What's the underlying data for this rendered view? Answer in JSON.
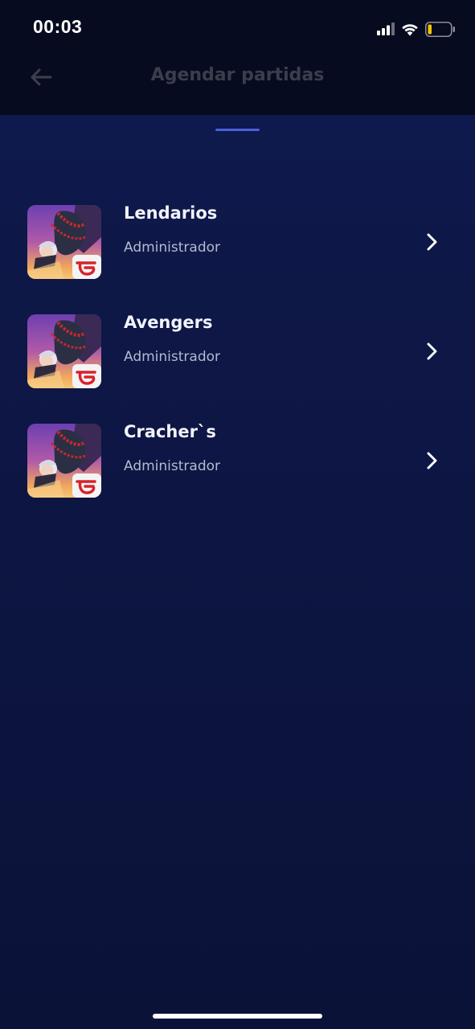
{
  "status_bar": {
    "time": "00:03",
    "icons": [
      "cellular-signal-icon",
      "wifi-icon",
      "battery-low-icon"
    ]
  },
  "header": {
    "back_icon": "arrow-left-icon",
    "title": "Agendar partidas"
  },
  "groups": [
    {
      "name": "Lendarios",
      "role": "Administrador",
      "icon": "game-thumbnail"
    },
    {
      "name": "Avengers",
      "role": "Administrador",
      "icon": "game-thumbnail"
    },
    {
      "name": "Cracher`s",
      "role": "Administrador",
      "icon": "game-thumbnail"
    }
  ],
  "colors": {
    "background": "#0c1335",
    "header_bg": "#070b1f",
    "tab_indicator": "#4a5fd8",
    "battery_level": "#f5c400"
  }
}
